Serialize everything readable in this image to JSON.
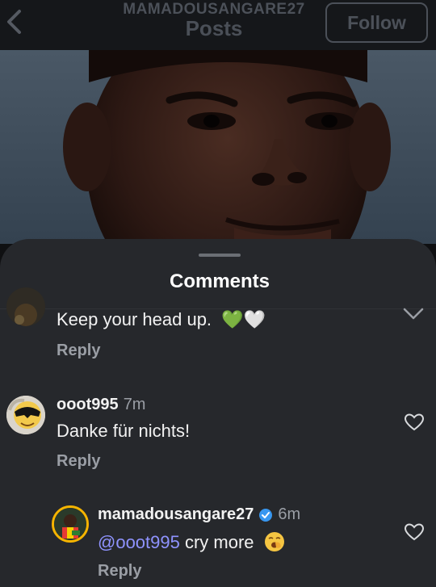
{
  "header": {
    "username": "MAMADOUSANGARE27",
    "section": "Posts",
    "follow_label": "Follow"
  },
  "sheet": {
    "title": "Comments"
  },
  "comments": [
    {
      "text": "Keep your head up.",
      "emoji": "💚🤍",
      "reply_label": "Reply"
    },
    {
      "username": "ooot995",
      "time": "7m",
      "text": "Danke für nichts!",
      "reply_label": "Reply"
    },
    {
      "username": "mamadousangare27",
      "time": "6m",
      "mention": "@ooot995",
      "text": " cry more",
      "reply_label": "Reply"
    }
  ],
  "icons": {
    "back": "chevron-left-icon",
    "collapse": "chevron-down-icon",
    "like": "heart-outline-icon",
    "verified": "verified-badge-icon",
    "emoji_yawn": "yawning-face-icon"
  },
  "colors": {
    "sheet_bg": "#26282c",
    "mention": "#8f93ff",
    "verified": "#3897f0"
  }
}
